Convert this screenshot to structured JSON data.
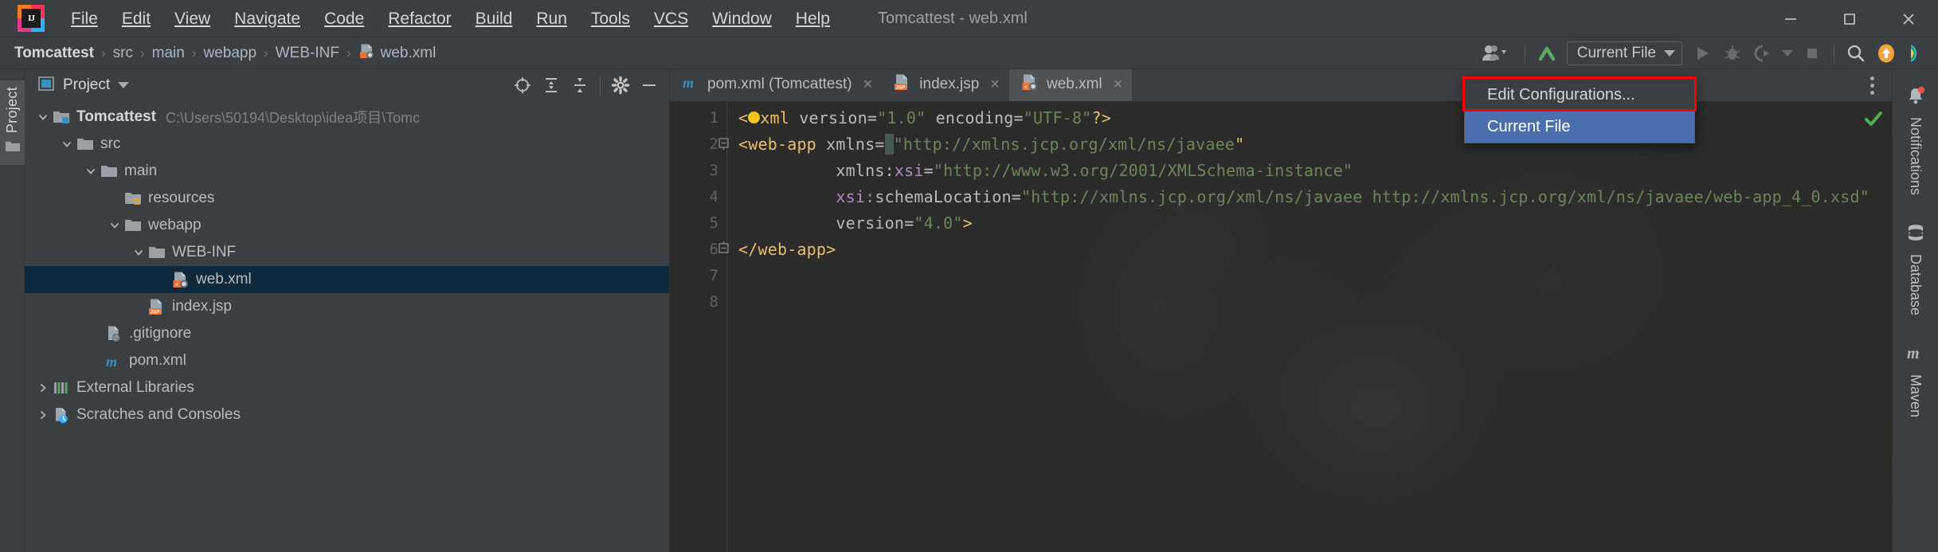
{
  "window": {
    "title": "Tomcattest - web.xml",
    "controls": {
      "minimize": "minimize-icon",
      "maximize": "maximize-icon",
      "close": "close-icon"
    }
  },
  "menubar": {
    "items": [
      {
        "label": "File",
        "mnemonic": "F"
      },
      {
        "label": "Edit",
        "mnemonic": "E"
      },
      {
        "label": "View",
        "mnemonic": "V"
      },
      {
        "label": "Navigate",
        "mnemonic": "N"
      },
      {
        "label": "Code",
        "mnemonic": "C"
      },
      {
        "label": "Refactor",
        "mnemonic": "R"
      },
      {
        "label": "Build",
        "mnemonic": "B"
      },
      {
        "label": "Run",
        "mnemonic": "u"
      },
      {
        "label": "Tools",
        "mnemonic": "T"
      },
      {
        "label": "VCS",
        "mnemonic": "V"
      },
      {
        "label": "Window",
        "mnemonic": "W"
      },
      {
        "label": "Help",
        "mnemonic": "H"
      }
    ]
  },
  "navbar": {
    "breadcrumbs": [
      {
        "label": "Tomcattest",
        "bold": true
      },
      {
        "label": "src",
        "bold": false
      },
      {
        "label": "main",
        "bold": false
      },
      {
        "label": "webapp",
        "bold": false
      },
      {
        "label": "WEB-INF",
        "bold": false
      },
      {
        "label": "web.xml",
        "bold": false,
        "icon": "xml-file-icon"
      }
    ],
    "separator": "›",
    "run_config": {
      "label": "Current File",
      "dropdown_icon": "chevron-down-icon"
    },
    "icons": [
      "user-account-icon",
      "updates-check-icon",
      "run-icon",
      "debug-icon",
      "run-coverage-icon",
      "profiler-icon",
      "stop-icon",
      "search-everywhere-icon",
      "update-project-icon",
      "ide-assistant-icon"
    ]
  },
  "run_popup": {
    "items": [
      {
        "label": "Edit Configurations...",
        "selected": false,
        "highlighted": true
      },
      {
        "label": "Current File",
        "selected": true,
        "highlighted": false
      }
    ],
    "highlight_color": "#ff0000",
    "selection_color": "#4b6eaf"
  },
  "left_rail": {
    "tab_label": "Project",
    "icon": "folder-icon"
  },
  "project_panel": {
    "title": "Project",
    "dropdown_icon": "chevron-down-icon",
    "toolbar_icons": [
      "select-opened-file-icon",
      "expand-all-icon",
      "collapse-all-icon",
      "settings-gear-icon",
      "hide-panel-icon"
    ],
    "tree": [
      {
        "depth": 0,
        "label": "Tomcattest",
        "path": "C:\\Users\\50194\\Desktop\\idea项目\\Tomc",
        "icon": "module-folder-icon",
        "arrow": "expanded",
        "bold": true,
        "selected": false
      },
      {
        "depth": 1,
        "label": "src",
        "path": "",
        "icon": "folder-icon",
        "arrow": "expanded",
        "bold": false,
        "selected": false
      },
      {
        "depth": 2,
        "label": "main",
        "path": "",
        "icon": "folder-icon",
        "arrow": "expanded",
        "bold": false,
        "selected": false
      },
      {
        "depth": 3,
        "label": "resources",
        "path": "",
        "icon": "resources-folder-icon",
        "arrow": "none",
        "bold": false,
        "selected": false
      },
      {
        "depth": 3,
        "label": "webapp",
        "path": "",
        "icon": "folder-icon",
        "arrow": "expanded",
        "bold": false,
        "selected": false
      },
      {
        "depth": 4,
        "label": "WEB-INF",
        "path": "",
        "icon": "folder-icon",
        "arrow": "expanded",
        "bold": false,
        "selected": false
      },
      {
        "depth": 5,
        "label": "web.xml",
        "path": "",
        "icon": "xml-file-icon",
        "arrow": "none",
        "bold": false,
        "selected": true
      },
      {
        "depth": 4,
        "label": "index.jsp",
        "path": "",
        "icon": "jsp-file-icon",
        "arrow": "none",
        "bold": false,
        "selected": false
      },
      {
        "depth": 2,
        "label": ".gitignore",
        "path": "",
        "icon": "gitignore-file-icon",
        "arrow": "none",
        "bold": false,
        "selected": false
      },
      {
        "depth": 2,
        "label": "pom.xml",
        "path": "",
        "icon": "maven-file-icon",
        "arrow": "none",
        "bold": false,
        "selected": false
      },
      {
        "depth": 0,
        "label": "External Libraries",
        "path": "",
        "icon": "libraries-icon",
        "arrow": "collapsed",
        "bold": false,
        "selected": false
      },
      {
        "depth": 0,
        "label": "Scratches and Consoles",
        "path": "",
        "icon": "scratches-icon",
        "arrow": "collapsed",
        "bold": false,
        "selected": false
      }
    ]
  },
  "editor_tabs": [
    {
      "label": "pom.xml (Tomcattest)",
      "icon": "maven-file-icon",
      "active": false,
      "close": "×"
    },
    {
      "label": "index.jsp",
      "icon": "jsp-file-icon",
      "active": false,
      "close": "×"
    },
    {
      "label": "web.xml",
      "icon": "xml-file-icon",
      "active": true,
      "close": "×"
    }
  ],
  "editor": {
    "overflow_icon": "more-vertical-icon",
    "inspection_status": {
      "icon": "check-mark-icon",
      "color": "#4caf50"
    },
    "line_numbers": [
      "1",
      "2",
      "3",
      "4",
      "5",
      "6",
      "7",
      "8"
    ],
    "lines": [
      {
        "n": 1,
        "segments": [
          {
            "t": "<",
            "c": "tag"
          },
          {
            "t": "?",
            "c": "bulb"
          },
          {
            "t": "xml ",
            "c": "tag"
          },
          {
            "t": "version",
            "c": "attr"
          },
          {
            "t": "=",
            "c": "eq"
          },
          {
            "t": "\"1.0\"",
            "c": "val"
          },
          {
            "t": " ",
            "c": "plain"
          },
          {
            "t": "encoding",
            "c": "attr"
          },
          {
            "t": "=",
            "c": "eq"
          },
          {
            "t": "\"UTF-8\"",
            "c": "val"
          },
          {
            "t": "?>",
            "c": "tag"
          }
        ]
      },
      {
        "n": 2,
        "segments": [
          {
            "t": "<web-app",
            "c": "tag"
          },
          {
            "t": " ",
            "c": "plain"
          },
          {
            "t": "xmlns",
            "c": "attr"
          },
          {
            "t": "=",
            "c": "eq"
          },
          {
            "t": "\"",
            "c": "cursor"
          },
          {
            "t": "http://xmlns.jcp.org/xml/ns/javaee",
            "c": "val"
          },
          {
            "t": "\"",
            "c": "val"
          }
        ]
      },
      {
        "n": 3,
        "segments": [
          {
            "t": "         ",
            "c": "plain"
          },
          {
            "t": "xmlns:",
            "c": "attr"
          },
          {
            "t": "xsi",
            "c": "ns"
          },
          {
            "t": "=",
            "c": "eq"
          },
          {
            "t": "\"http://www.w3.org/2001/XMLSchema-instance\"",
            "c": "val"
          }
        ]
      },
      {
        "n": 4,
        "segments": [
          {
            "t": "         ",
            "c": "plain"
          },
          {
            "t": "xsi:",
            "c": "ns"
          },
          {
            "t": "schemaLocation",
            "c": "attr"
          },
          {
            "t": "=",
            "c": "eq"
          },
          {
            "t": "\"http://xmlns.jcp.org/xml/ns/javaee http://xmlns.jcp.org/xml/ns/javaee/web-app_4_0.xsd\"",
            "c": "val"
          }
        ]
      },
      {
        "n": 5,
        "segments": [
          {
            "t": "         ",
            "c": "plain"
          },
          {
            "t": "version",
            "c": "attr"
          },
          {
            "t": "=",
            "c": "eq"
          },
          {
            "t": "\"4.0\"",
            "c": "val"
          },
          {
            "t": ">",
            "c": "tag"
          }
        ]
      },
      {
        "n": 6,
        "segments": [
          {
            "t": "</web-app>",
            "c": "tag"
          }
        ]
      },
      {
        "n": 7,
        "segments": []
      },
      {
        "n": 8,
        "segments": []
      }
    ]
  },
  "right_rail": {
    "items": [
      {
        "label": "Notifications",
        "icon": "bell-icon",
        "badge": true,
        "badge_color": "#e8543f"
      },
      {
        "label": "Database",
        "icon": "database-icon",
        "badge": false
      },
      {
        "label": "Maven",
        "icon": "maven-icon",
        "badge": false
      }
    ]
  },
  "colors": {
    "chrome": "#3c3f41",
    "editor_bg": "#2b2b2b",
    "selection_blue": "#4b6eaf",
    "tree_selection": "#0d293e",
    "accent_orange": "#f2a33c",
    "tag_yellow": "#e8bf6a",
    "string_green": "#6a8759",
    "ns_purple": "#b389c5"
  }
}
